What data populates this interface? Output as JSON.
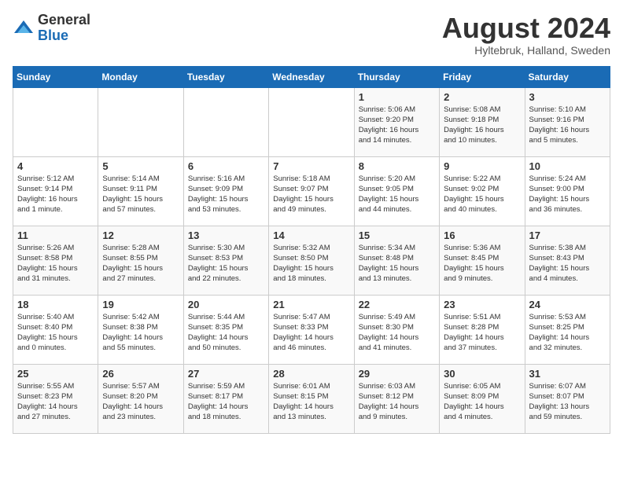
{
  "header": {
    "logo_general": "General",
    "logo_blue": "Blue",
    "month_year": "August 2024",
    "location": "Hyltebruk, Halland, Sweden"
  },
  "weekdays": [
    "Sunday",
    "Monday",
    "Tuesday",
    "Wednesday",
    "Thursday",
    "Friday",
    "Saturday"
  ],
  "weeks": [
    [
      {
        "day": "",
        "info": ""
      },
      {
        "day": "",
        "info": ""
      },
      {
        "day": "",
        "info": ""
      },
      {
        "day": "",
        "info": ""
      },
      {
        "day": "1",
        "info": "Sunrise: 5:06 AM\nSunset: 9:20 PM\nDaylight: 16 hours\nand 14 minutes."
      },
      {
        "day": "2",
        "info": "Sunrise: 5:08 AM\nSunset: 9:18 PM\nDaylight: 16 hours\nand 10 minutes."
      },
      {
        "day": "3",
        "info": "Sunrise: 5:10 AM\nSunset: 9:16 PM\nDaylight: 16 hours\nand 5 minutes."
      }
    ],
    [
      {
        "day": "4",
        "info": "Sunrise: 5:12 AM\nSunset: 9:14 PM\nDaylight: 16 hours\nand 1 minute."
      },
      {
        "day": "5",
        "info": "Sunrise: 5:14 AM\nSunset: 9:11 PM\nDaylight: 15 hours\nand 57 minutes."
      },
      {
        "day": "6",
        "info": "Sunrise: 5:16 AM\nSunset: 9:09 PM\nDaylight: 15 hours\nand 53 minutes."
      },
      {
        "day": "7",
        "info": "Sunrise: 5:18 AM\nSunset: 9:07 PM\nDaylight: 15 hours\nand 49 minutes."
      },
      {
        "day": "8",
        "info": "Sunrise: 5:20 AM\nSunset: 9:05 PM\nDaylight: 15 hours\nand 44 minutes."
      },
      {
        "day": "9",
        "info": "Sunrise: 5:22 AM\nSunset: 9:02 PM\nDaylight: 15 hours\nand 40 minutes."
      },
      {
        "day": "10",
        "info": "Sunrise: 5:24 AM\nSunset: 9:00 PM\nDaylight: 15 hours\nand 36 minutes."
      }
    ],
    [
      {
        "day": "11",
        "info": "Sunrise: 5:26 AM\nSunset: 8:58 PM\nDaylight: 15 hours\nand 31 minutes."
      },
      {
        "day": "12",
        "info": "Sunrise: 5:28 AM\nSunset: 8:55 PM\nDaylight: 15 hours\nand 27 minutes."
      },
      {
        "day": "13",
        "info": "Sunrise: 5:30 AM\nSunset: 8:53 PM\nDaylight: 15 hours\nand 22 minutes."
      },
      {
        "day": "14",
        "info": "Sunrise: 5:32 AM\nSunset: 8:50 PM\nDaylight: 15 hours\nand 18 minutes."
      },
      {
        "day": "15",
        "info": "Sunrise: 5:34 AM\nSunset: 8:48 PM\nDaylight: 15 hours\nand 13 minutes."
      },
      {
        "day": "16",
        "info": "Sunrise: 5:36 AM\nSunset: 8:45 PM\nDaylight: 15 hours\nand 9 minutes."
      },
      {
        "day": "17",
        "info": "Sunrise: 5:38 AM\nSunset: 8:43 PM\nDaylight: 15 hours\nand 4 minutes."
      }
    ],
    [
      {
        "day": "18",
        "info": "Sunrise: 5:40 AM\nSunset: 8:40 PM\nDaylight: 15 hours\nand 0 minutes."
      },
      {
        "day": "19",
        "info": "Sunrise: 5:42 AM\nSunset: 8:38 PM\nDaylight: 14 hours\nand 55 minutes."
      },
      {
        "day": "20",
        "info": "Sunrise: 5:44 AM\nSunset: 8:35 PM\nDaylight: 14 hours\nand 50 minutes."
      },
      {
        "day": "21",
        "info": "Sunrise: 5:47 AM\nSunset: 8:33 PM\nDaylight: 14 hours\nand 46 minutes."
      },
      {
        "day": "22",
        "info": "Sunrise: 5:49 AM\nSunset: 8:30 PM\nDaylight: 14 hours\nand 41 minutes."
      },
      {
        "day": "23",
        "info": "Sunrise: 5:51 AM\nSunset: 8:28 PM\nDaylight: 14 hours\nand 37 minutes."
      },
      {
        "day": "24",
        "info": "Sunrise: 5:53 AM\nSunset: 8:25 PM\nDaylight: 14 hours\nand 32 minutes."
      }
    ],
    [
      {
        "day": "25",
        "info": "Sunrise: 5:55 AM\nSunset: 8:23 PM\nDaylight: 14 hours\nand 27 minutes."
      },
      {
        "day": "26",
        "info": "Sunrise: 5:57 AM\nSunset: 8:20 PM\nDaylight: 14 hours\nand 23 minutes."
      },
      {
        "day": "27",
        "info": "Sunrise: 5:59 AM\nSunset: 8:17 PM\nDaylight: 14 hours\nand 18 minutes."
      },
      {
        "day": "28",
        "info": "Sunrise: 6:01 AM\nSunset: 8:15 PM\nDaylight: 14 hours\nand 13 minutes."
      },
      {
        "day": "29",
        "info": "Sunrise: 6:03 AM\nSunset: 8:12 PM\nDaylight: 14 hours\nand 9 minutes."
      },
      {
        "day": "30",
        "info": "Sunrise: 6:05 AM\nSunset: 8:09 PM\nDaylight: 14 hours\nand 4 minutes."
      },
      {
        "day": "31",
        "info": "Sunrise: 6:07 AM\nSunset: 8:07 PM\nDaylight: 13 hours\nand 59 minutes."
      }
    ]
  ]
}
